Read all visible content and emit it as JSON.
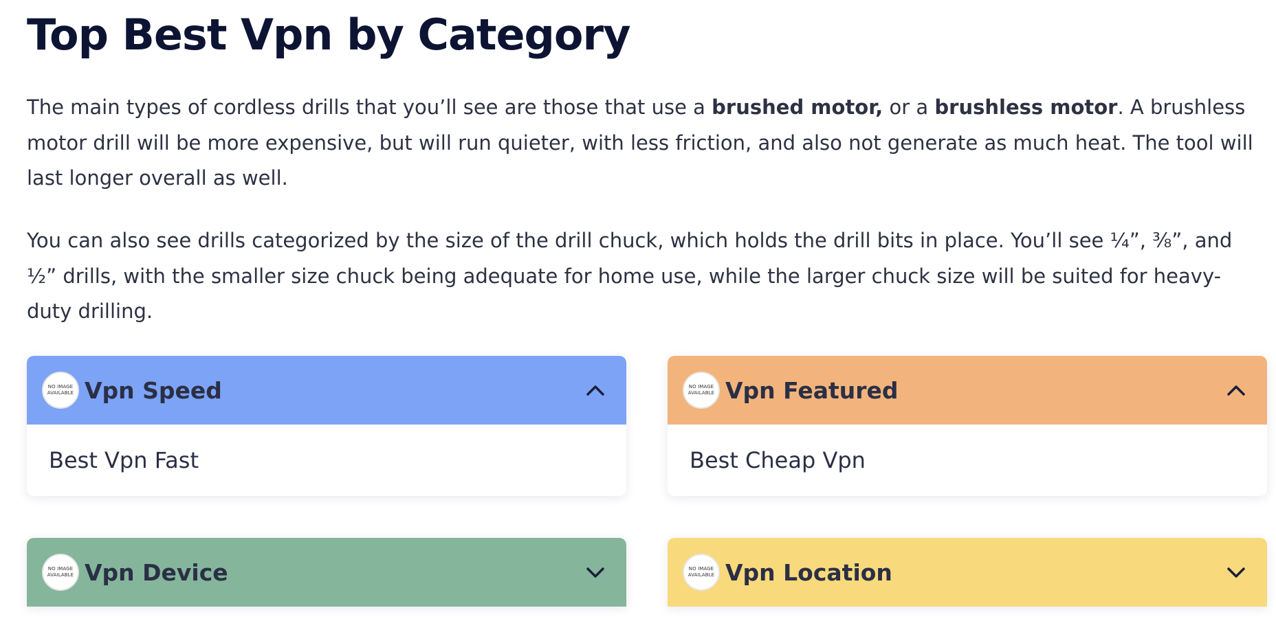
{
  "page": {
    "title": "Top Best Vpn by Category",
    "para1": {
      "part1": "The main types of cordless drills that you’ll see are those that use a ",
      "bold1": "brushed motor,",
      "part2": " or a ",
      "bold2": "brushless motor",
      "part3": ". A brushless motor drill will be more expensive, but will run quieter, with less friction, and also not generate as much heat. The tool will last longer overall as well."
    },
    "para2": "You can also see drills categorized by the size of the drill chuck, which holds the drill bits in place. You’ll see ¼”, ⅜”, and ½” drills, with the smaller size chuck being adequate for home use, while the larger chuck size will be suited for heavy-duty drilling."
  },
  "thumb_text": "NO IMAGE AVAILABLE",
  "categories": [
    {
      "title": "Vpn Speed",
      "color": "#7ca3f5",
      "expanded": true,
      "chevron": "chevron-up-icon",
      "items": [
        "Best Vpn Fast"
      ]
    },
    {
      "title": "Vpn Featured",
      "color": "#f2b47c",
      "expanded": true,
      "chevron": "chevron-up-icon",
      "items": [
        "Best Cheap Vpn"
      ]
    },
    {
      "title": "Vpn Device",
      "color": "#85b59b",
      "expanded": false,
      "chevron": "chevron-down-icon",
      "items": []
    },
    {
      "title": "Vpn Location",
      "color": "#f8d97c",
      "expanded": false,
      "chevron": "chevron-down-icon",
      "items": []
    }
  ]
}
